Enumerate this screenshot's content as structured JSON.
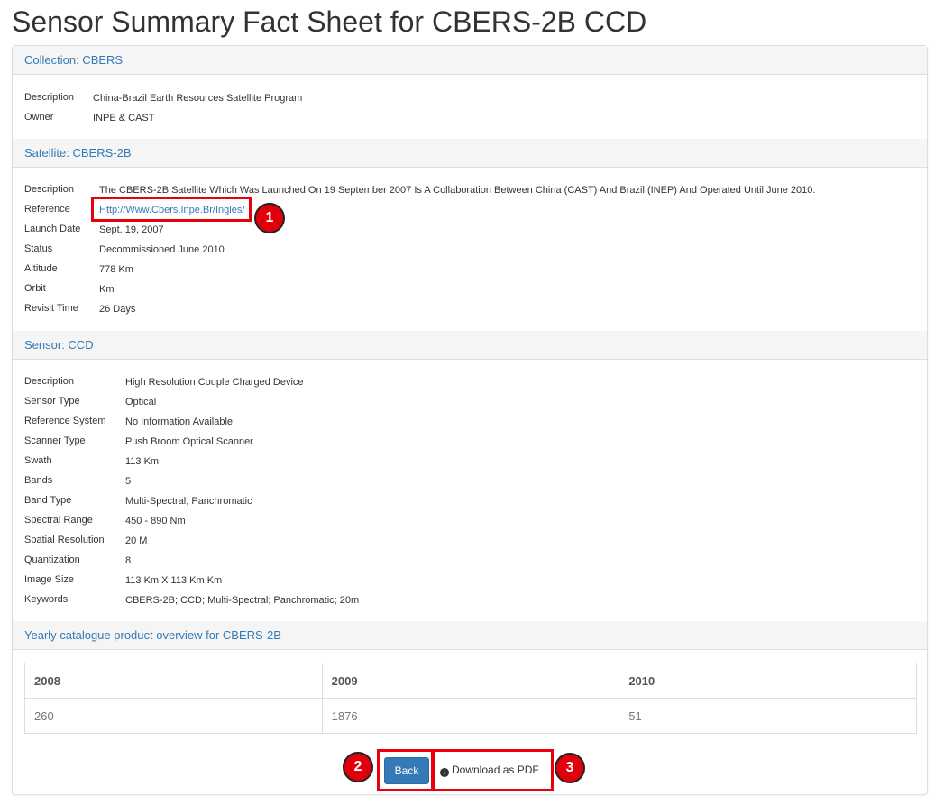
{
  "page_title": "Sensor Summary Fact Sheet for CBERS-2B CCD",
  "collection": {
    "heading": "Collection: CBERS",
    "rows": [
      {
        "label": "Description",
        "value": "China-Brazil Earth Resources Satellite Program"
      },
      {
        "label": "Owner",
        "value": "INPE & CAST"
      }
    ]
  },
  "satellite": {
    "heading": "Satellite: CBERS-2B",
    "rows": [
      {
        "label": "Description",
        "value": "The CBERS-2B Satellite Which Was Launched On 19 September 2007 Is A Collaboration Between China (CAST) And Brazil (INEP) And Operated Until June 2010."
      },
      {
        "label": "Reference",
        "value": "Http://Www.Cbers.Inpe.Br/Ingles/"
      },
      {
        "label": "Launch Date",
        "value": "Sept. 19, 2007"
      },
      {
        "label": "Status",
        "value": "Decommissioned June 2010"
      },
      {
        "label": "Altitude",
        "value": "778 Km"
      },
      {
        "label": "Orbit",
        "value": "Km"
      },
      {
        "label": "Revisit Time",
        "value": "26 Days"
      }
    ]
  },
  "sensor": {
    "heading": "Sensor: CCD",
    "rows": [
      {
        "label": "Description",
        "value": "High Resolution Couple Charged Device"
      },
      {
        "label": "Sensor Type",
        "value": "Optical"
      },
      {
        "label": "Reference System",
        "value": "No Information Available"
      },
      {
        "label": "Scanner Type",
        "value": "Push Broom Optical Scanner"
      },
      {
        "label": "Swath",
        "value": "113 Km"
      },
      {
        "label": "Bands",
        "value": "5"
      },
      {
        "label": "Band Type",
        "value": "Multi-Spectral; Panchromatic"
      },
      {
        "label": "Spectral Range",
        "value": "450 - 890 Nm"
      },
      {
        "label": "Spatial Resolution",
        "value": "20 M"
      },
      {
        "label": "Quantization",
        "value": "8"
      },
      {
        "label": "Image Size",
        "value": "113 Km X 113 Km Km"
      },
      {
        "label": "Keywords",
        "value": "CBERS-2B; CCD; Multi-Spectral; Panchromatic; 20m"
      }
    ]
  },
  "yearly": {
    "heading": "Yearly catalogue product overview for CBERS-2B",
    "headers": [
      "2008",
      "2009",
      "2010"
    ],
    "values": [
      "260",
      "1876",
      "51"
    ]
  },
  "buttons": {
    "back_label": "Back",
    "pdf_label": "Download as PDF"
  },
  "annotations": [
    "1",
    "2",
    "3"
  ],
  "colors": {
    "link": "#337ab7",
    "button_primary": "#337ab7",
    "annotation_red": "#e0000b",
    "section_header_bg": "#f5f5f5"
  }
}
